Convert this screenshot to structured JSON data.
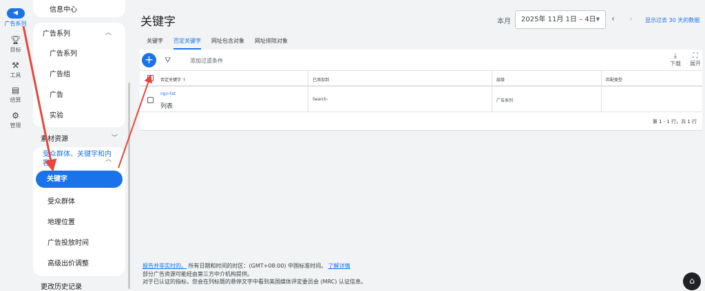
{
  "rail": [
    {
      "icon": "megaphone-icon",
      "glyph": "📢",
      "label": "广告系列",
      "active": true
    },
    {
      "icon": "trophy-icon",
      "glyph": "🏆",
      "label": "目标"
    },
    {
      "icon": "tools-icon",
      "glyph": "⚒",
      "label": "工具"
    },
    {
      "icon": "credit-card-icon",
      "glyph": "▤",
      "label": "结算"
    },
    {
      "icon": "gear-icon",
      "glyph": "⚙",
      "label": "管理"
    }
  ],
  "sidebar": {
    "info_center": "信息中心",
    "campaigns_header": "广告系列",
    "campaign_items": [
      "广告系列",
      "广告组",
      "广告",
      "实验"
    ],
    "assets": "素材资源",
    "audience_section": "受众群体、关键字和内容",
    "active_item": "关键字",
    "audience_items": [
      "受众群体",
      "地理位置",
      "广告投放时间",
      "高级出价调整"
    ],
    "history": "更改历史记录"
  },
  "header": {
    "title": "关键字",
    "month_label": "本月",
    "date_range": "2025年 11月 1日 – 4日",
    "show_30": "显示过去 30 天的数据"
  },
  "tabs": [
    "关键字",
    "否定关键字",
    "网址包含对象",
    "网址排除对象"
  ],
  "active_tab": 1,
  "toolbar": {
    "add_filter": "添加过滤条件",
    "download": "下载",
    "expand": "展开"
  },
  "table": {
    "columns": [
      "否定关键字 ↑",
      "已添加到",
      "层级",
      "匹配类型"
    ],
    "rows": [
      {
        "keyword_link": "ngv-list",
        "keyword": "列表",
        "added_to": "Search-",
        "level": "广告系列",
        "match_type": ""
      }
    ],
    "pagination": "第 1 - 1 行，共 1 行"
  },
  "footer": {
    "not_realtime": "报告并非实时的。",
    "timezone": "所有日期和时间的时区：(GMT+08:00) 中国标准时间。",
    "learn_more": "了解详情",
    "line2": "部分广告资源可能经由第三方中介机构提供。",
    "line3": "对于已认证的指标，您会在列标题的悬停文字中看到美国媒体评定委员会 (MRC) 认证信息。"
  },
  "colors": {
    "accent": "#1a73e8",
    "annotation": "#e8453c"
  }
}
